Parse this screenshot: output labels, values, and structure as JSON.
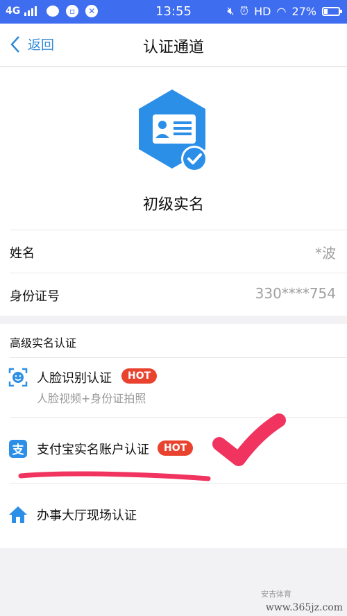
{
  "status_bar": {
    "network": "4G",
    "time": "13:55",
    "hd": "HD",
    "battery": "27%",
    "battery_level": 0.27
  },
  "nav": {
    "back_label": "返回",
    "title": "认证通道"
  },
  "hero": {
    "level_label": "初级实名"
  },
  "info_rows": [
    {
      "label": "姓名",
      "value": "*波"
    },
    {
      "label": "身份证号",
      "value": "330****754"
    }
  ],
  "advanced": {
    "heading": "高级实名认证",
    "options": [
      {
        "name": "人脸识别认证",
        "badge": "HOT",
        "subtitle": "人脸视频+身份证拍照",
        "icon": "face-recognition-icon"
      },
      {
        "name": "支付宝实名账户认证",
        "badge": "HOT",
        "icon": "alipay-icon"
      },
      {
        "name": "办事大厅现场认证",
        "icon": "home-icon"
      }
    ]
  },
  "watermark": {
    "source": "安吉体育",
    "url": "www.365jz.com"
  },
  "colors": {
    "status_bar": "#3f6df0",
    "link_blue": "#2f8ad8",
    "hot_red": "#e9432f",
    "annotation_red": "#f0345f",
    "badge_blue": "#2b8fe8"
  }
}
